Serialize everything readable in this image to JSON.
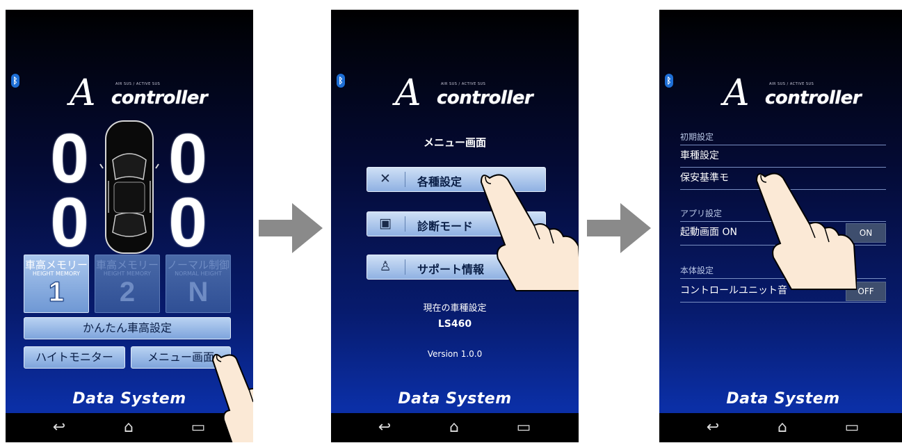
{
  "screens": [
    {
      "logo": {
        "glyph": "A",
        "word": "controller",
        "tiny": "AIR SUS / ACTIVE SUS"
      },
      "digits": [
        "0",
        "0",
        "0",
        "0"
      ],
      "memory_buttons": [
        {
          "jp": "車高メモリー",
          "en": "HEIGHT MEMORY",
          "big": "1",
          "state": "active"
        },
        {
          "jp": "車高メモリー",
          "en": "HEIGHT MEMORY",
          "big": "2",
          "state": "inactive"
        },
        {
          "jp": "ノーマル制御",
          "en": "NORMAL HEIGHT",
          "big": "N",
          "state": "inactive"
        }
      ],
      "kantan_label": "かんたん車高設定",
      "height_monitor_label": "ハイトモニター",
      "menu_label": "メニュー画面",
      "brand": "Data System"
    },
    {
      "logo": {
        "glyph": "A",
        "word": "controller",
        "tiny": "AIR SUS / ACTIVE SUS"
      },
      "title": "メニュー画面",
      "menu_items": [
        {
          "label": "各種設定",
          "icon": "wrench-icon",
          "glyph": "✕"
        },
        {
          "label": "診断モード",
          "icon": "clipboard-icon",
          "glyph": "▣"
        },
        {
          "label": "サポート情報",
          "icon": "person-icon",
          "glyph": "♙"
        }
      ],
      "current_car_label": "現在の車種設定",
      "car_model": "LS460",
      "version": "Version 1.0.0",
      "brand": "Data System"
    },
    {
      "logo": {
        "glyph": "A",
        "word": "controller",
        "tiny": "AIR SUS / ACTIVE SUS"
      },
      "section_initial": "初期設定",
      "car_setting": "車種設定",
      "safety_mode": "保安基準モ",
      "section_app": "アプリ設定",
      "startup_label": "起動画面 ON",
      "startup_value": "ON",
      "section_body": "本体設定",
      "unit_sound_label": "コントロールユニット音",
      "unit_sound_value": "OFF",
      "brand": "Data System"
    }
  ],
  "nav": {
    "back": "↩",
    "home": "⌂",
    "recent": "▭"
  }
}
